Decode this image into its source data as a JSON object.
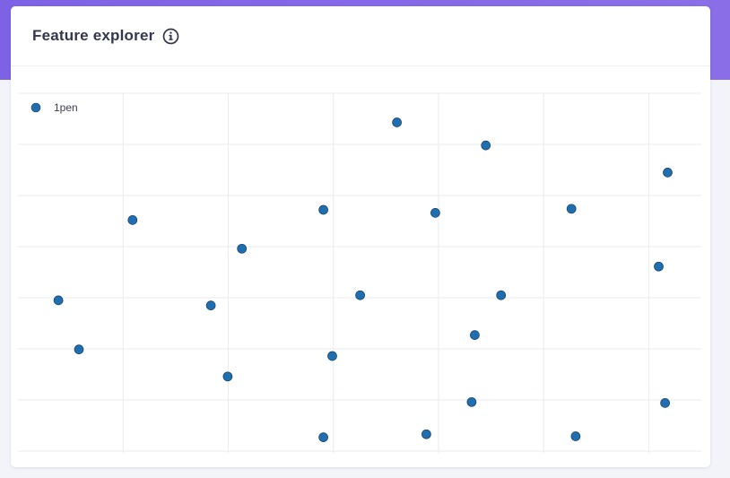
{
  "card": {
    "title": "Feature explorer",
    "info_icon": "info-circle-icon"
  },
  "colors": {
    "banner": "#8067e6",
    "title": "#33364f",
    "point_fill": "#1f6fb0",
    "point_stroke": "#123d66",
    "grid": "#e9ebef"
  },
  "chart_data": {
    "type": "scatter",
    "title": "",
    "xlabel": "",
    "ylabel": "",
    "xlim": [
      0,
      13
    ],
    "ylim": [
      0,
      7
    ],
    "grid": true,
    "legend_position": "top-left",
    "series": [
      {
        "name": "1pen",
        "points": [
          [
            0.77,
            2.95
          ],
          [
            1.16,
            1.99
          ],
          [
            2.18,
            4.52
          ],
          [
            3.67,
            2.85
          ],
          [
            3.99,
            1.46
          ],
          [
            4.26,
            3.96
          ],
          [
            5.81,
            4.72
          ],
          [
            5.81,
            0.27
          ],
          [
            5.98,
            1.86
          ],
          [
            6.51,
            3.05
          ],
          [
            7.21,
            6.43
          ],
          [
            7.77,
            0.33
          ],
          [
            7.94,
            4.66
          ],
          [
            8.63,
            0.96
          ],
          [
            8.69,
            2.27
          ],
          [
            8.9,
            5.98
          ],
          [
            9.19,
            3.05
          ],
          [
            10.53,
            4.74
          ],
          [
            10.61,
            0.29
          ],
          [
            12.19,
            3.61
          ],
          [
            12.31,
            0.94
          ],
          [
            12.36,
            5.45
          ]
        ]
      }
    ]
  }
}
